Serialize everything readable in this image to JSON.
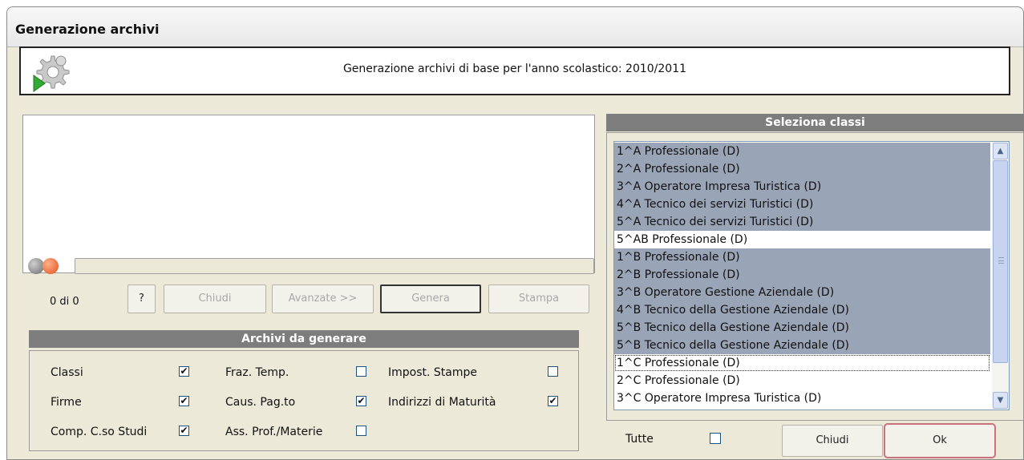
{
  "window": {
    "title": "Generazione archivi"
  },
  "header": {
    "text": "Generazione archivi di base per l'anno scolastico: 2010/2011"
  },
  "progress": {
    "count_text": "0 di 0",
    "value": 0
  },
  "buttons": {
    "help": "?",
    "chiudi": "Chiudi",
    "avanzate": "Avanzate >>",
    "genera": "Genera",
    "stampa": "Stampa"
  },
  "archivi": {
    "title": "Archivi da generare",
    "options": [
      {
        "label": "Classi",
        "checked": true
      },
      {
        "label": "Firme",
        "checked": true
      },
      {
        "label": "Comp. C.so Studi",
        "checked": true
      },
      {
        "label": "Fraz. Temp.",
        "checked": false
      },
      {
        "label": "Caus. Pag.to",
        "checked": true
      },
      {
        "label": "Ass. Prof./Materie",
        "checked": false
      },
      {
        "label": "Impost. Stampe",
        "checked": false
      },
      {
        "label": "Indirizzi di Maturità",
        "checked": true
      }
    ]
  },
  "classi": {
    "title": "Seleziona classi",
    "items": [
      {
        "label": "1^A Professionale (D)",
        "selected": true
      },
      {
        "label": "2^A Professionale (D)",
        "selected": true
      },
      {
        "label": "3^A Operatore Impresa Turistica (D)",
        "selected": true
      },
      {
        "label": "4^A Tecnico dei servizi Turistici (D)",
        "selected": true
      },
      {
        "label": "5^A Tecnico dei servizi Turistici (D)",
        "selected": true
      },
      {
        "label": "5^AB Professionale (D)",
        "selected": false
      },
      {
        "label": "1^B Professionale (D)",
        "selected": true
      },
      {
        "label": "2^B Professionale (D)",
        "selected": true
      },
      {
        "label": "3^B Operatore Gestione Aziendale (D)",
        "selected": true
      },
      {
        "label": "4^B Tecnico della Gestione Aziendale (D)",
        "selected": true
      },
      {
        "label": "5^B Tecnico della Gestione Aziendale (D)",
        "selected": true
      },
      {
        "label": "5^B Tecnico della Gestione Aziendale (D)",
        "selected": true
      },
      {
        "label": "1^C Professionale (D)",
        "selected": false,
        "focused": true
      },
      {
        "label": "2^C Professionale (D)",
        "selected": false
      },
      {
        "label": "3^C Operatore Impresa Turistica (D)",
        "selected": false
      }
    ],
    "tutte_label": "Tutte",
    "tutte_checked": false
  },
  "footer": {
    "chiudi": "Chiudi",
    "ok": "Ok"
  },
  "colors": {
    "selection": "#9aa4b7",
    "section_bar": "#7d7d7d",
    "ok_border": "#c9727f"
  },
  "icons": {
    "header": "gear-play-icon",
    "scroll_up": "arrow-up-icon",
    "scroll_down": "arrow-down-icon"
  }
}
